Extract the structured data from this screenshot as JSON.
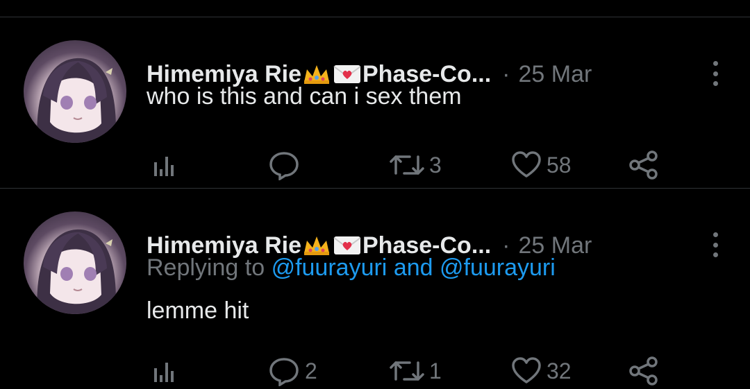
{
  "tweets": [
    {
      "author": "Himemiya Rie",
      "author_suffix": "Phase-Co...",
      "separator": "·",
      "date": "25 Mar",
      "replying_prefix": "",
      "replying_to_1": "",
      "replying_and": "",
      "replying_to_2": "",
      "text": "who is this and can i sex them",
      "actions": {
        "views": "",
        "replies": "",
        "retweets": "3",
        "likes": "58"
      }
    },
    {
      "author": "Himemiya Rie",
      "author_suffix": "Phase-Co...",
      "separator": "·",
      "date": "25 Mar",
      "replying_prefix": "Replying to",
      "replying_to_1": "@fuurayuri",
      "replying_and": "and",
      "replying_to_2": "@fuurayuri",
      "text": "lemme hit",
      "actions": {
        "views": "",
        "replies": "2",
        "retweets": "1",
        "likes": "32"
      }
    }
  ],
  "icons": {
    "views": "bar-chart-icon",
    "reply": "speech-bubble-icon",
    "retweet": "retweet-icon",
    "like": "heart-icon",
    "share": "share-icon",
    "more": "more-dots-icon",
    "emoji_1": "crown-emoji",
    "emoji_2": "love-letter-emoji"
  },
  "colors": {
    "background": "#000000",
    "text": "#e7e9ea",
    "muted": "#71767b",
    "link": "#1d9bf0",
    "divider": "#2f3336"
  }
}
